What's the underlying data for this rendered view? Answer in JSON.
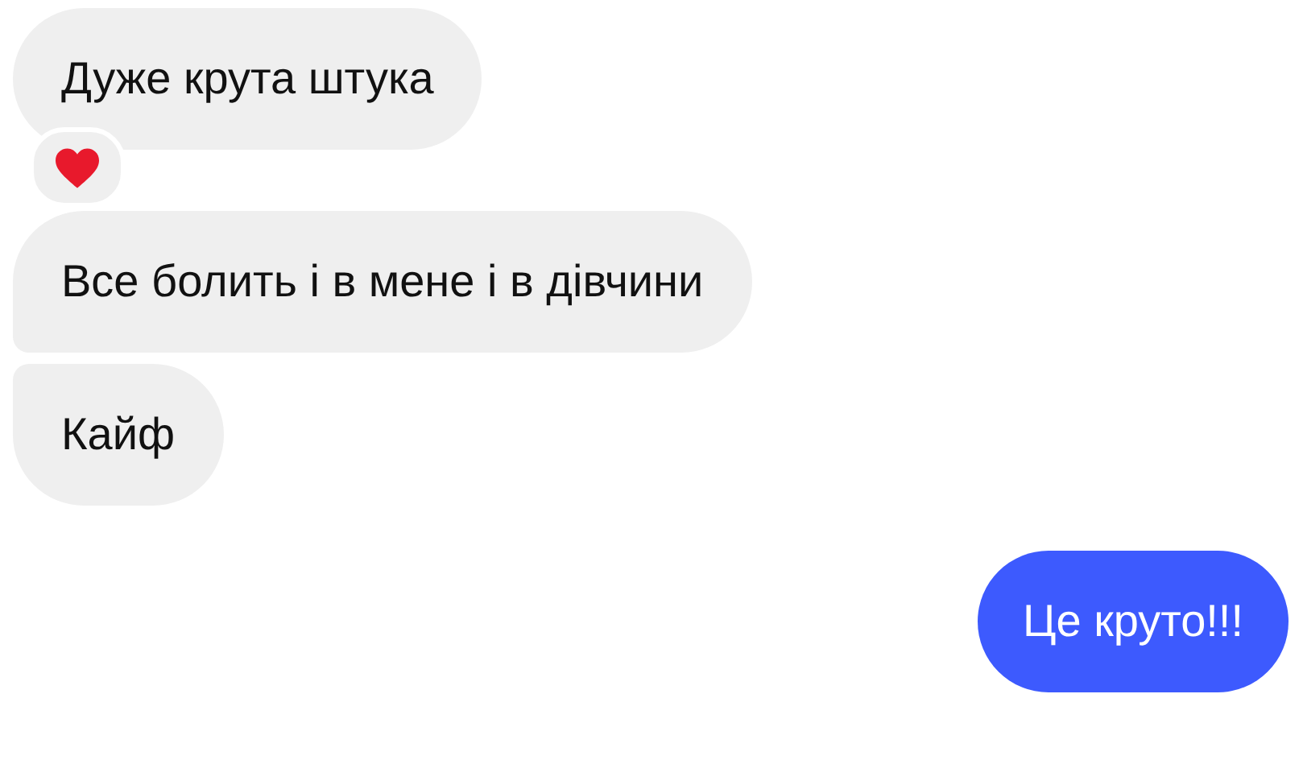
{
  "messages": [
    {
      "kind": "incoming",
      "text": "Дуже крута штука",
      "joined_above": false,
      "joined_below": false,
      "reaction": {
        "kind": "heart"
      }
    },
    {
      "kind": "incoming",
      "text": "Все болить і в мене і в дівчини",
      "joined_above": false,
      "joined_below": true
    },
    {
      "kind": "incoming",
      "text": "Кайф",
      "joined_above": true,
      "joined_below": false
    },
    {
      "kind": "outgoing",
      "text": "Це круто!!!",
      "joined_above": false,
      "joined_below": false
    }
  ]
}
